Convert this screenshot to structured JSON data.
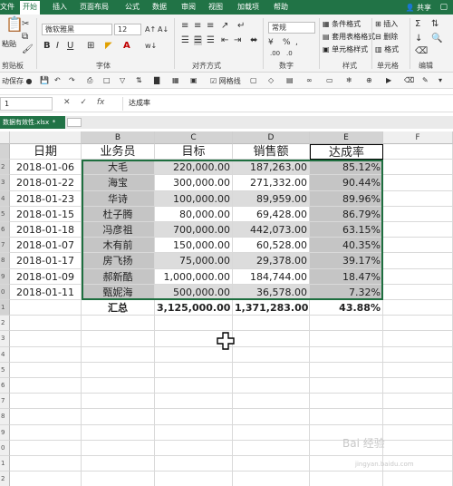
{
  "ribbon_tabs": [
    {
      "label": "文件"
    },
    {
      "label": "开始"
    },
    {
      "label": "插入"
    },
    {
      "label": "页面布局"
    },
    {
      "label": "公式"
    },
    {
      "label": "数据"
    },
    {
      "label": "审阅"
    },
    {
      "label": "视图"
    },
    {
      "label": "加载项"
    },
    {
      "label": "帮助"
    }
  ],
  "share_label": "共享",
  "ribbon": {
    "clipboard": {
      "paste": "粘贴",
      "label": "剪贴板"
    },
    "font": {
      "name": "微软雅黑",
      "size": "12",
      "label": "字体"
    },
    "alignment": {
      "label": "对齐方式"
    },
    "number": {
      "format": "常规",
      "label": "数字"
    },
    "styles": {
      "conditional": "条件格式",
      "table": "套用表格格式",
      "cell_styles": "单元格样式",
      "label": "样式"
    },
    "cells": {
      "insert": "插入",
      "delete": "删除",
      "format": "格式",
      "label": "单元格"
    },
    "editing": {
      "label": "编辑"
    }
  },
  "qat": {
    "autosave": "动保存",
    "gridlines": "网格线"
  },
  "formula_bar": {
    "name_box": "1",
    "fx": "fx",
    "formula": "达成率"
  },
  "workbook_tab": "数据有效性.xlsx",
  "columns": [
    "B",
    "C",
    "D",
    "E",
    "F"
  ],
  "col_a_label": "",
  "row_numbers": [
    "",
    "2",
    "3",
    "4",
    "5",
    "6",
    "7",
    "8",
    "9",
    "0",
    "1",
    "2",
    "3",
    "4",
    "5",
    "6",
    "7",
    "8",
    "9",
    "0",
    "1",
    "2"
  ],
  "table": {
    "headers": [
      "日期",
      "业务员",
      "目标",
      "销售额",
      "达成率"
    ],
    "rows": [
      [
        "2018-01-06",
        "大毛",
        "220,000.00",
        "187,263.00",
        "85.12%"
      ],
      [
        "2018-01-22",
        "海宝",
        "300,000.00",
        "271,332.00",
        "90.44%"
      ],
      [
        "2018-01-23",
        "华诗",
        "100,000.00",
        "89,959.00",
        "89.96%"
      ],
      [
        "2018-01-15",
        "杜子腾",
        "80,000.00",
        "69,428.00",
        "86.79%"
      ],
      [
        "2018-01-18",
        "冯彦祖",
        "700,000.00",
        "442,073.00",
        "63.15%"
      ],
      [
        "2018-01-07",
        "木有前",
        "150,000.00",
        "60,528.00",
        "40.35%"
      ],
      [
        "2018-01-17",
        "房飞扬",
        "75,000.00",
        "29,378.00",
        "39.17%"
      ],
      [
        "2018-01-09",
        "郝新酷",
        "1,000,000.00",
        "184,744.00",
        "18.47%"
      ],
      [
        "2018-01-11",
        "甄妮海",
        "500,000.00",
        "36,578.00",
        "7.32%"
      ]
    ],
    "total": [
      "汇总",
      "3,125,000.00",
      "1,371,283.00",
      "43.88%"
    ]
  },
  "watermark": "Bai 经验",
  "watermark_sub": "jingyan.baidu.com"
}
